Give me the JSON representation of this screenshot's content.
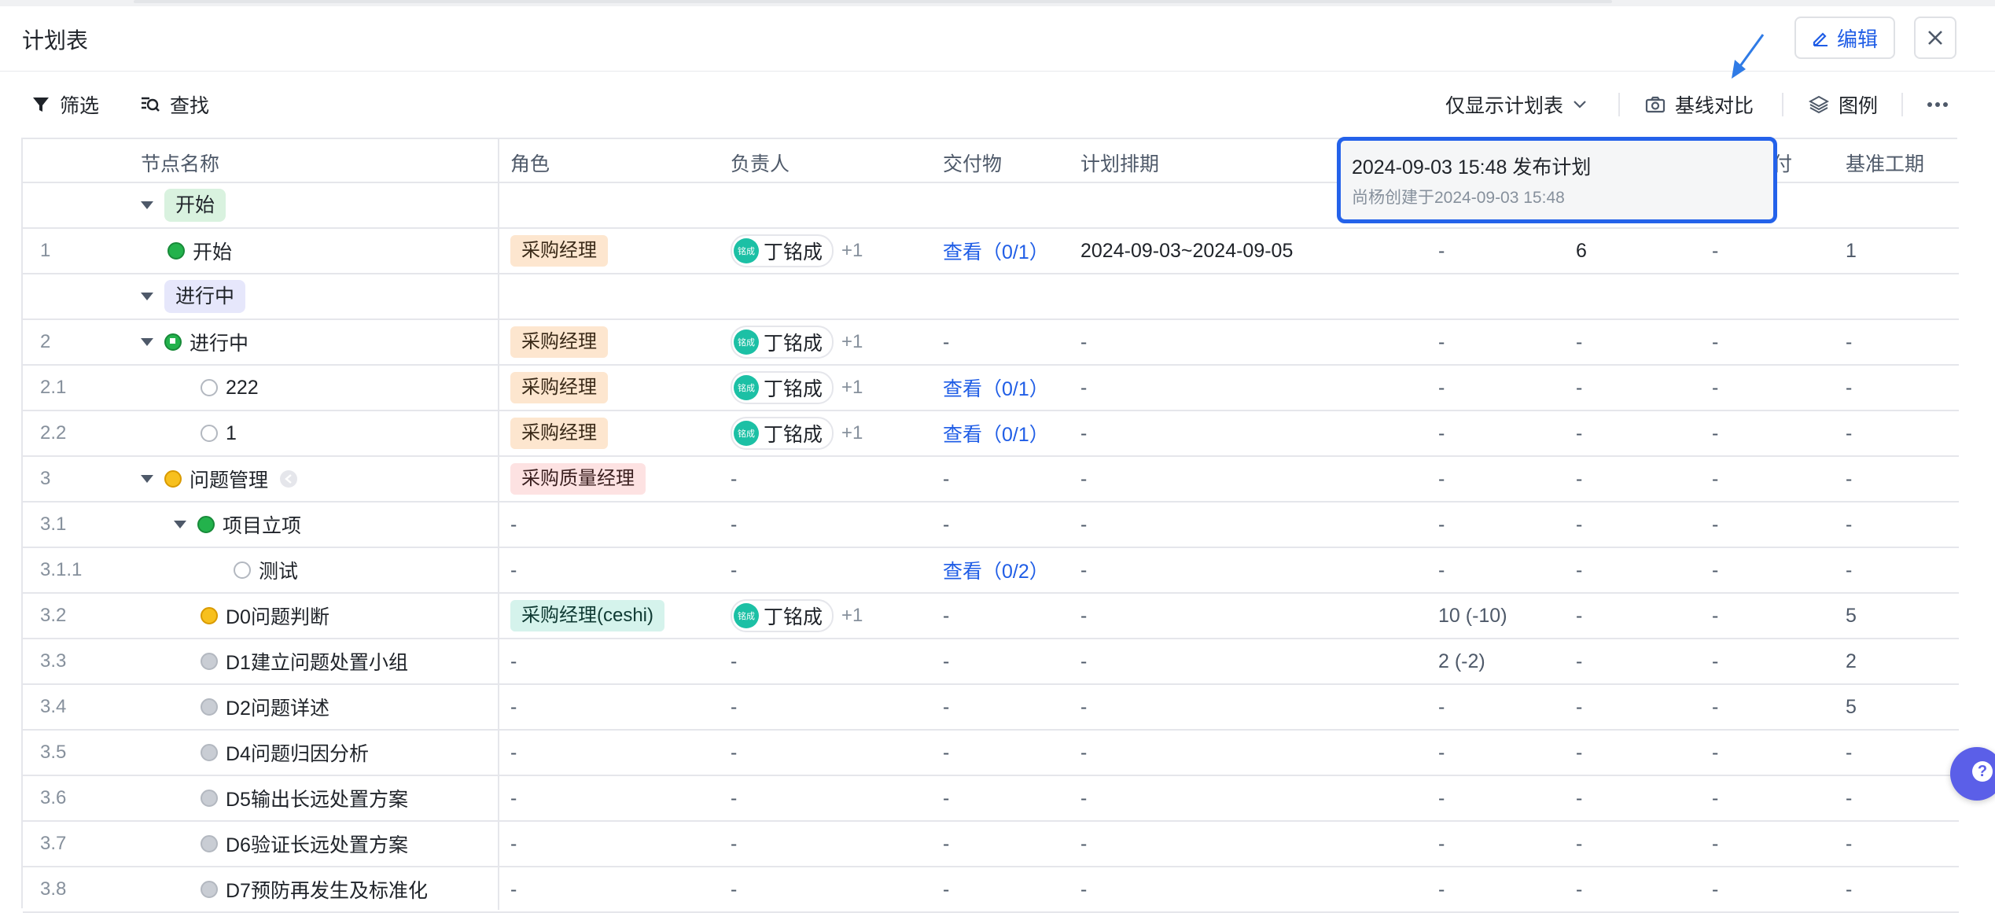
{
  "header": {
    "title": "计划表",
    "edit_label": "编辑"
  },
  "toolbar": {
    "filter": "筛选",
    "find": "查找",
    "view_select": "仅显示计划表",
    "baseline": "基线对比",
    "legend": "图例"
  },
  "columns": {
    "node_name": "节点名称",
    "role": "角色",
    "owner": "负责人",
    "deliverable": "交付物",
    "schedule": "计划排期",
    "partial": "付",
    "baseline_duration": "基准工期"
  },
  "popover": {
    "title": "2024-09-03 15:48 发布计划",
    "subtitle": "尚杨创建于2024-09-03 15:48"
  },
  "groups": {
    "start": "开始",
    "in_progress": "进行中"
  },
  "avatar_text": "铭成",
  "rows": [
    {
      "num": "1",
      "name": "开始",
      "role": "采购经理",
      "owner": "丁铭成",
      "plus": "+1",
      "deliverable": "查看（0/1）",
      "schedule": "2024-09-03~2024-09-05",
      "c5": "-",
      "c6": "6",
      "c7": "-",
      "c8": "1"
    },
    {
      "num": "2",
      "name": "进行中",
      "role": "采购经理",
      "owner": "丁铭成",
      "plus": "+1",
      "deliverable": "-",
      "schedule": "-",
      "c5": "-",
      "c6": "-",
      "c7": "-",
      "c8": "-"
    },
    {
      "num": "2.1",
      "name": "222",
      "role": "采购经理",
      "owner": "丁铭成",
      "plus": "+1",
      "deliverable": "查看（0/1）",
      "schedule": "-",
      "c5": "-",
      "c6": "-",
      "c7": "-",
      "c8": "-"
    },
    {
      "num": "2.2",
      "name": "1",
      "role": "采购经理",
      "owner": "丁铭成",
      "plus": "+1",
      "deliverable": "查看（0/1）",
      "schedule": "-",
      "c5": "-",
      "c6": "-",
      "c7": "-",
      "c8": "-"
    },
    {
      "num": "3",
      "name": "问题管理",
      "role": "采购质量经理",
      "owner": "-",
      "plus": "",
      "deliverable": "-",
      "schedule": "-",
      "c5": "-",
      "c6": "-",
      "c7": "-",
      "c8": "-"
    },
    {
      "num": "3.1",
      "name": "项目立项",
      "role": "-",
      "owner": "-",
      "plus": "",
      "deliverable": "-",
      "schedule": "-",
      "c5": "-",
      "c6": "-",
      "c7": "-",
      "c8": "-"
    },
    {
      "num": "3.1.1",
      "name": "测试",
      "role": "-",
      "owner": "-",
      "plus": "",
      "deliverable": "查看（0/2）",
      "schedule": "-",
      "c5": "-",
      "c6": "-",
      "c7": "-",
      "c8": "-"
    },
    {
      "num": "3.2",
      "name": "D0问题判断",
      "role": "采购经理(ceshi)",
      "owner": "丁铭成",
      "plus": "+1",
      "deliverable": "-",
      "schedule": "-",
      "c5": "10 (-10)",
      "c6": "-",
      "c7": "-",
      "c8": "5"
    },
    {
      "num": "3.3",
      "name": "D1建立问题处置小组",
      "role": "-",
      "owner": "-",
      "plus": "",
      "deliverable": "-",
      "schedule": "-",
      "c5": "2 (-2)",
      "c6": "-",
      "c7": "-",
      "c8": "2"
    },
    {
      "num": "3.4",
      "name": "D2问题详述",
      "role": "-",
      "owner": "-",
      "plus": "",
      "deliverable": "-",
      "schedule": "-",
      "c5": "-",
      "c6": "-",
      "c7": "-",
      "c8": "5"
    },
    {
      "num": "3.5",
      "name": "D4问题归因分析",
      "role": "-",
      "owner": "-",
      "plus": "",
      "deliverable": "-",
      "schedule": "-",
      "c5": "-",
      "c6": "-",
      "c7": "-",
      "c8": "-"
    },
    {
      "num": "3.6",
      "name": "D5输出长远处置方案",
      "role": "-",
      "owner": "-",
      "plus": "",
      "deliverable": "-",
      "schedule": "-",
      "c5": "-",
      "c6": "-",
      "c7": "-",
      "c8": "-"
    },
    {
      "num": "3.7",
      "name": "D6验证长远处置方案",
      "role": "-",
      "owner": "-",
      "plus": "",
      "deliverable": "-",
      "schedule": "-",
      "c5": "-",
      "c6": "-",
      "c7": "-",
      "c8": "-"
    },
    {
      "num": "3.8",
      "name": "D7预防再发生及标准化",
      "role": "-",
      "owner": "-",
      "plus": "",
      "deliverable": "-",
      "schedule": "-",
      "c5": "-",
      "c6": "-",
      "c7": "-",
      "c8": "-"
    }
  ],
  "colors": {
    "accent": "#1f5de6",
    "popover_border": "#2462ea",
    "help_button": "#5b5fe8"
  }
}
